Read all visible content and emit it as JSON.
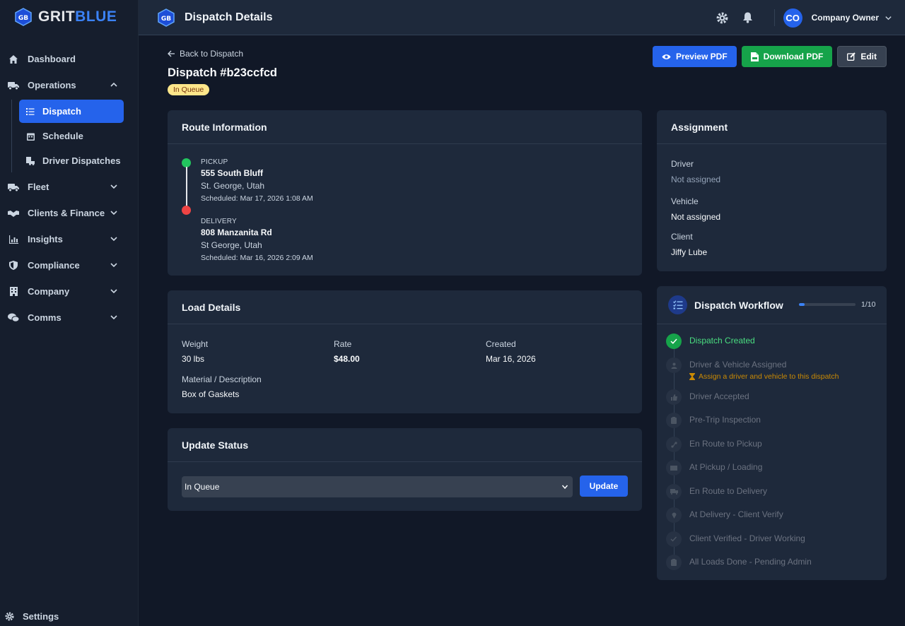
{
  "brand": {
    "name_part1": "GRIT",
    "name_part2": "BLUE",
    "logo_text": "GB"
  },
  "sidebar": {
    "items": [
      {
        "label": "Dashboard"
      },
      {
        "label": "Operations"
      },
      {
        "label": "Fleet"
      },
      {
        "label": "Clients & Finance"
      },
      {
        "label": "Insights"
      },
      {
        "label": "Compliance"
      },
      {
        "label": "Company"
      },
      {
        "label": "Comms"
      }
    ],
    "sub_items": [
      {
        "label": "Dispatch",
        "active": true
      },
      {
        "label": "Schedule"
      },
      {
        "label": "Driver Dispatches"
      }
    ],
    "settings_label": "Settings"
  },
  "header": {
    "title": "Dispatch Details",
    "user_initials": "CO",
    "user_name": "Company Owner"
  },
  "page": {
    "back_label": "Back to Dispatch",
    "title": "Dispatch #b23ccfcd",
    "status_badge": "In Queue",
    "actions": {
      "preview": "Preview PDF",
      "download": "Download PDF",
      "edit": "Edit"
    }
  },
  "route": {
    "heading": "Route Information",
    "pickup": {
      "label": "PICKUP",
      "address": "555 South Bluff",
      "city": "St. George, Utah",
      "scheduled": "Scheduled: Mar 17, 2026 1:08 AM"
    },
    "delivery": {
      "label": "DELIVERY",
      "address": "808 Manzanita Rd",
      "city": "St George, Utah",
      "scheduled": "Scheduled: Mar 16, 2026 2:09 AM"
    }
  },
  "load": {
    "heading": "Load Details",
    "weight_label": "Weight",
    "weight": "30 lbs",
    "rate_label": "Rate",
    "rate": "$48.00",
    "created_label": "Created",
    "created": "Mar 16, 2026",
    "material_label": "Material / Description",
    "material": "Box of Gaskets"
  },
  "update": {
    "heading": "Update Status",
    "selected": "In Queue",
    "button": "Update"
  },
  "assignment": {
    "heading": "Assignment",
    "driver_label": "Driver",
    "driver": "Not assigned",
    "vehicle_label": "Vehicle",
    "vehicle": "Not assigned",
    "client_label": "Client",
    "client": "Jiffy Lube"
  },
  "workflow": {
    "heading": "Dispatch Workflow",
    "progress_text": "1/10",
    "progress_fraction": 0.1,
    "hint": "Assign a driver and vehicle to this dispatch",
    "steps": [
      {
        "label": "Dispatch Created",
        "done": true
      },
      {
        "label": "Driver & Vehicle Assigned"
      },
      {
        "label": "Driver Accepted"
      },
      {
        "label": "Pre-Trip Inspection"
      },
      {
        "label": "En Route to Pickup"
      },
      {
        "label": "At Pickup / Loading"
      },
      {
        "label": "En Route to Delivery"
      },
      {
        "label": "At Delivery - Client Verify"
      },
      {
        "label": "Client Verified - Driver Working"
      },
      {
        "label": "All Loads Done - Pending Admin"
      }
    ]
  },
  "colors": {
    "accent": "#2563eb",
    "success": "#16a34a",
    "danger": "#ef4444",
    "warning": "#ca8a04"
  }
}
